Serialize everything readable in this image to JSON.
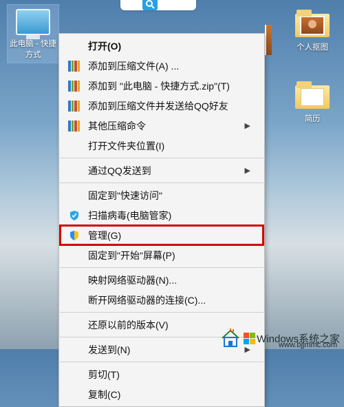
{
  "desktop": {
    "selected_icon_label": "此电脑 - 快捷方式",
    "icons": [
      {
        "label": "个人抠图"
      },
      {
        "label": "简历"
      }
    ]
  },
  "context_menu": {
    "open": "打开(O)",
    "add_to_archive": "添加到压缩文件(A) ...",
    "add_to_named_zip": "添加到 \"此电脑 - 快捷方式.zip\"(T)",
    "add_and_send_qq": "添加到压缩文件并发送给QQ好友",
    "other_compress": "其他压缩命令",
    "open_file_location": "打开文件夹位置(I)",
    "send_via_qq": "通过QQ发送到",
    "pin_quick_access": "固定到\"快速访问\"",
    "scan_virus": "扫描病毒(电脑管家)",
    "manage": "管理(G)",
    "pin_start": "固定到\"开始\"屏幕(P)",
    "map_drive": "映射网络驱动器(N)...",
    "disconnect_drive": "断开网络驱动器的连接(C)...",
    "restore_previous": "还原以前的版本(V)",
    "send_to": "发送到(N)",
    "cut": "剪切(T)",
    "copy": "复制(C)"
  },
  "watermark": {
    "title": "Windows系统之家",
    "url": "www.bjjmmc.com"
  }
}
